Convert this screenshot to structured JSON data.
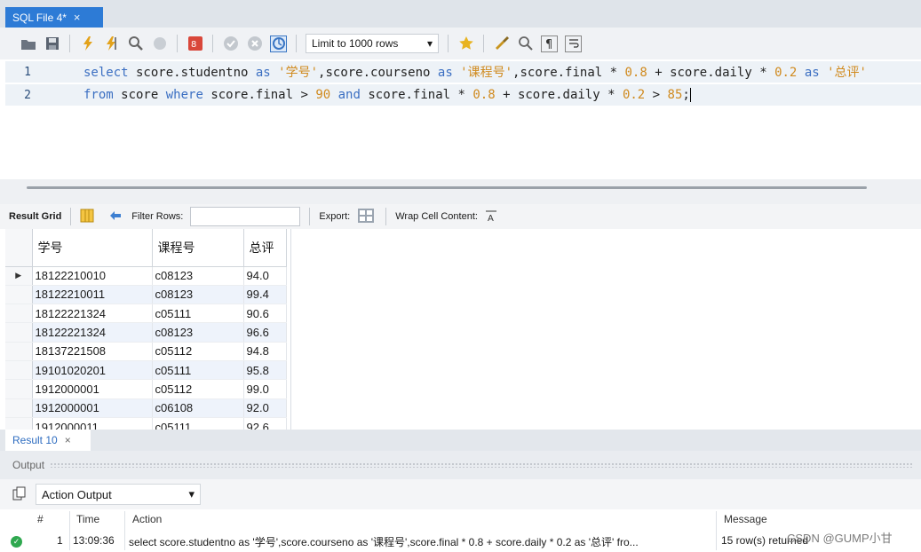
{
  "tab": {
    "title": "SQL File 4*",
    "close": "×"
  },
  "toolbar": {
    "limit_label": "Limit to 1000 rows",
    "dropdown_arrow": "▾"
  },
  "editor": {
    "lines": [
      {
        "number": "1"
      },
      {
        "number": "2"
      }
    ]
  },
  "code": {
    "l1": {
      "kw_select": "select",
      "t1": " score.studentno ",
      "kw_as1": "as",
      "s1": " '学号'",
      "t2": ",score.courseno ",
      "kw_as2": "as",
      "s2": " '课程号'",
      "t3": ",score.final * ",
      "n1": "0.8",
      "t4": " + score.daily * ",
      "n2": "0.2",
      "t5": " ",
      "kw_as3": "as",
      "s3": " '总评'"
    },
    "l2": {
      "kw_from": "from",
      "t1": " score ",
      "kw_where": "where",
      "t2": " score.final > ",
      "n1": "90",
      "t3": " ",
      "kw_and": "and",
      "t4": " score.final * ",
      "n2": "0.8",
      "t5": " + score.daily * ",
      "n3": "0.2",
      "t6": " > ",
      "n4": "85",
      "t7": ";"
    }
  },
  "result_toolbar": {
    "result_grid": "Result Grid",
    "filter_rows": "Filter Rows:",
    "export": "Export:",
    "wrap": "Wrap Cell Content:"
  },
  "grid": {
    "headers": [
      "学号",
      "课程号",
      "总评"
    ],
    "rows": [
      [
        "18122210010",
        "c08123",
        "94.0"
      ],
      [
        "18122210011",
        "c08123",
        "99.4"
      ],
      [
        "18122221324",
        "c05111",
        "90.6"
      ],
      [
        "18122221324",
        "c08123",
        "96.6"
      ],
      [
        "18137221508",
        "c05112",
        "94.8"
      ],
      [
        "19101020201",
        "c05111",
        "95.8"
      ],
      [
        "1912000001",
        "c05112",
        "99.0"
      ],
      [
        "1912000001",
        "c06108",
        "92.0"
      ],
      [
        "1912000011",
        "c05111",
        "92.6"
      ]
    ],
    "current_row_marker": "▶"
  },
  "result_tab": {
    "label": "Result 10",
    "close": "×"
  },
  "output": {
    "title": "Output",
    "selector": "Action Output",
    "columns": {
      "num": "#",
      "time": "Time",
      "action": "Action",
      "message": "Message"
    },
    "row": {
      "num": "1",
      "time": "13:09:36",
      "action": "select score.studentno as '学号',score.courseno as '课程号',score.final * 0.8 + score.daily * 0.2 as '总评' fro...",
      "message": "15 row(s) returned"
    }
  },
  "watermark": "CSDN @GUMP小甘",
  "colors": {
    "tab_blue": "#2d7bd6",
    "keyword": "#3b6fc2",
    "string": "#d08a1e",
    "ok_green": "#2fa84f"
  }
}
